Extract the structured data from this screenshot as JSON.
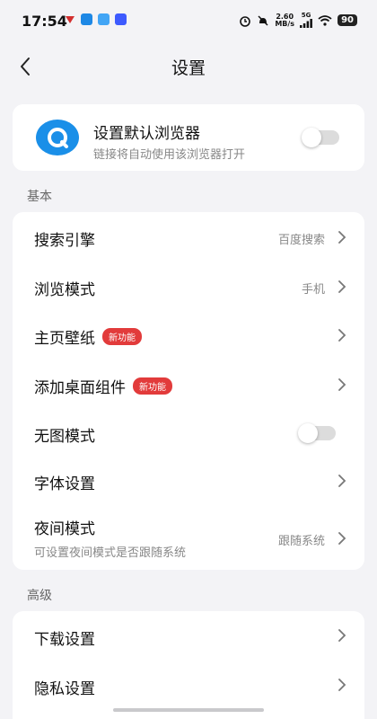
{
  "status_bar": {
    "time": "17:54",
    "speed_value": "2.60",
    "speed_unit": "MB/s",
    "network": "5G",
    "battery": "90"
  },
  "nav": {
    "title": "设置"
  },
  "default_browser": {
    "title": "设置默认浏览器",
    "subtitle": "链接将自动使用该浏览器打开",
    "toggle_on": false
  },
  "sections": {
    "basic": {
      "label": "基本",
      "items": [
        {
          "label": "搜索引擎",
          "value": "百度搜索"
        },
        {
          "label": "浏览模式",
          "value": "手机"
        },
        {
          "label": "主页壁纸",
          "badge": "新功能"
        },
        {
          "label": "添加桌面组件",
          "badge": "新功能"
        },
        {
          "label": "无图模式",
          "toggle_on": false
        },
        {
          "label": "字体设置"
        },
        {
          "label": "夜间模式",
          "subtitle": "可设置夜间模式是否跟随系统",
          "value": "跟随系统"
        }
      ]
    },
    "advanced": {
      "label": "高级",
      "items": [
        {
          "label": "下载设置"
        },
        {
          "label": "隐私设置"
        }
      ]
    }
  },
  "colors": {
    "background": "#f3f3f6",
    "badge": "#e23b3b",
    "app_icon": "#1a8fe8"
  }
}
